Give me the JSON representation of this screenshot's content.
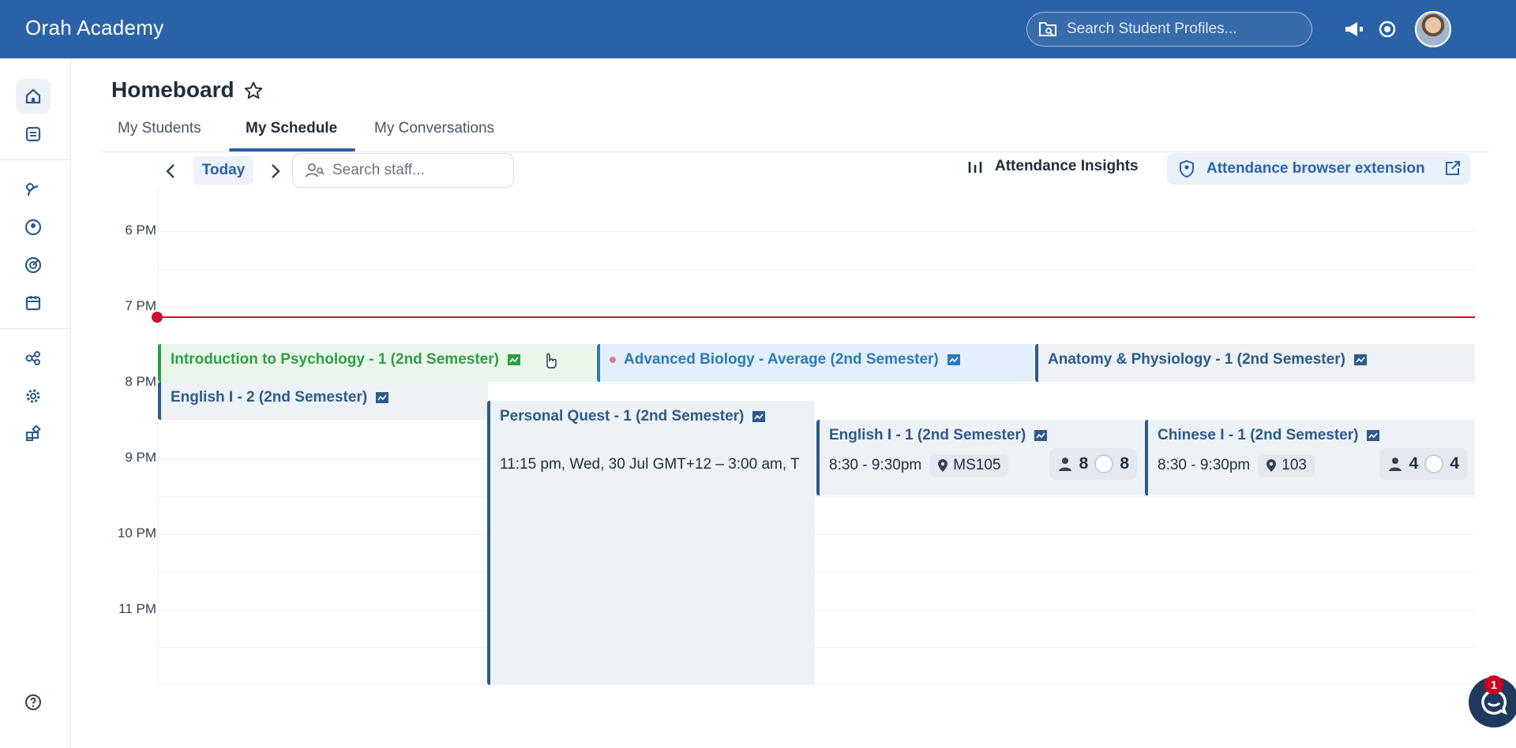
{
  "app": {
    "title": "Orah Academy"
  },
  "search": {
    "placeholder": "Search Student Profiles..."
  },
  "page": {
    "title": "Homeboard"
  },
  "tabs": [
    {
      "label": "My Students",
      "active": false
    },
    {
      "label": "My Schedule",
      "active": true
    },
    {
      "label": "My Conversations",
      "active": false
    }
  ],
  "toolbar": {
    "today_label": "Today",
    "staff_search_placeholder": "Search staff...",
    "insights_label": "Attendance Insights",
    "extension_label": "Attendance browser extension"
  },
  "calendar": {
    "hours": [
      "6 PM",
      "7 PM",
      "8 PM",
      "9 PM",
      "10 PM",
      "11 PM"
    ],
    "events": [
      {
        "title": "Introduction to Psychology - 1 (2nd Semester)",
        "color": "#2e9e46",
        "bg": "#e9f6ea"
      },
      {
        "title": "Advanced Biology - Average (2nd Semester)",
        "color": "#2b7ab8",
        "bg": "#e3f0fb"
      },
      {
        "title": "Anatomy & Physiology - 1 (2nd Semester)",
        "color": "#2b5a8c",
        "bg": "#eef1f5"
      },
      {
        "title": "English I - 2 (2nd Semester)",
        "color": "#2b5a8c",
        "bg": "#eef1f5"
      },
      {
        "title": "Personal Quest - 1 (2nd Semester)",
        "time": "11:15 pm, Wed, 30 Jul GMT+12 – 3:00 am, T",
        "color": "#2b5a8c",
        "bg": "#eef1f5"
      },
      {
        "title": "English I - 1 (2nd Semester)",
        "time": "8:30 - 9:30pm",
        "room": "MS105",
        "students": "8",
        "marked": "8",
        "color": "#2b5a8c",
        "bg": "#eef1f5"
      },
      {
        "title": "Chinese I - 1 (2nd Semester)",
        "time": "8:30 - 9:30pm",
        "room": "103",
        "students": "4",
        "marked": "4",
        "color": "#2b5a8c",
        "bg": "#eef1f5"
      }
    ]
  },
  "chat": {
    "badge": "1"
  },
  "colors": {
    "brand": "#2b62a7",
    "now_line": "#c8102e"
  }
}
